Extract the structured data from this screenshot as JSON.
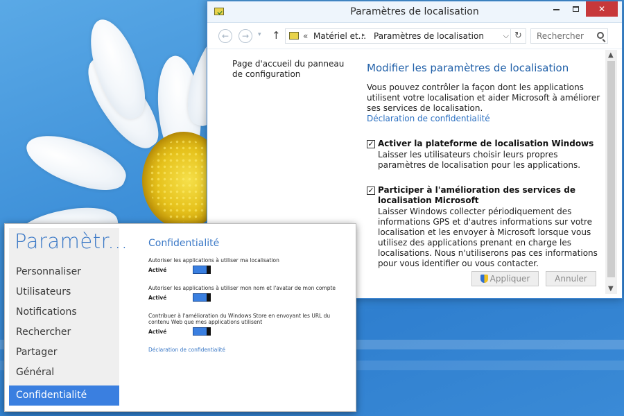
{
  "control_panel": {
    "title": "Paramètres de localisation",
    "breadcrumb": {
      "overflow": "«",
      "segment1": "Matériel et...",
      "separator": "▸",
      "segment2": "Paramètres de localisation"
    },
    "search_placeholder": "Rechercher",
    "left_link": "Page d'accueil du panneau de configuration",
    "heading": "Modifier les paramètres de localisation",
    "intro": "Vous pouvez contrôler la façon dont les applications utilisent votre localisation et aider Microsoft à améliorer ses services de localisation.",
    "privacy_link": "Déclaration de confidentialité",
    "options": [
      {
        "title": "Activer la plateforme de localisation Windows",
        "description": "Laisser les utilisateurs choisir leurs propres paramètres de localisation pour les applications.",
        "checked": true
      },
      {
        "title": "Participer à l'amélioration des services de localisation Microsoft",
        "description": "Laisser Windows collecter périodiquement des informations GPS et d'autres informations sur votre localisation et les envoyer à Microsoft lorsque vous utilisez des applications prenant en charge les localisations. Nous n'utiliserons pas ces informations pour vous identifier ou vous contacter.",
        "checked": true
      }
    ],
    "apply_label": "Appliquer",
    "cancel_label": "Annuler"
  },
  "pc_settings": {
    "title": "Paramètr...",
    "nav": [
      "Personnaliser",
      "Utilisateurs",
      "Notifications",
      "Rechercher",
      "Partager",
      "Général",
      "Confidentialité"
    ],
    "active_index": 6,
    "heading": "Confidentialité",
    "settings": [
      {
        "label": "Autoriser les applications à utiliser ma localisation",
        "state": "Activé",
        "on": true
      },
      {
        "label": "Autoriser les applications à utiliser mon nom et l'avatar de mon compte",
        "state": "Activé",
        "on": true
      },
      {
        "label": "Contribuer à l'amélioration du Windows Store en envoyant les URL du contenu Web que mes applications utilisent",
        "state": "Activé",
        "on": true
      }
    ],
    "privacy_link": "Déclaration de confidentialité"
  },
  "colors": {
    "accent": "#3a7fe0",
    "link": "#2a6fc1",
    "close_button": "#c7383a",
    "desktop": "#3d8fd8"
  },
  "icons": {
    "app": "control-panel-icon",
    "back": "back-arrow-icon",
    "forward": "forward-arrow-icon",
    "up": "up-arrow-icon",
    "refresh": "refresh-icon",
    "search": "search-icon",
    "shield": "uac-shield-icon"
  }
}
